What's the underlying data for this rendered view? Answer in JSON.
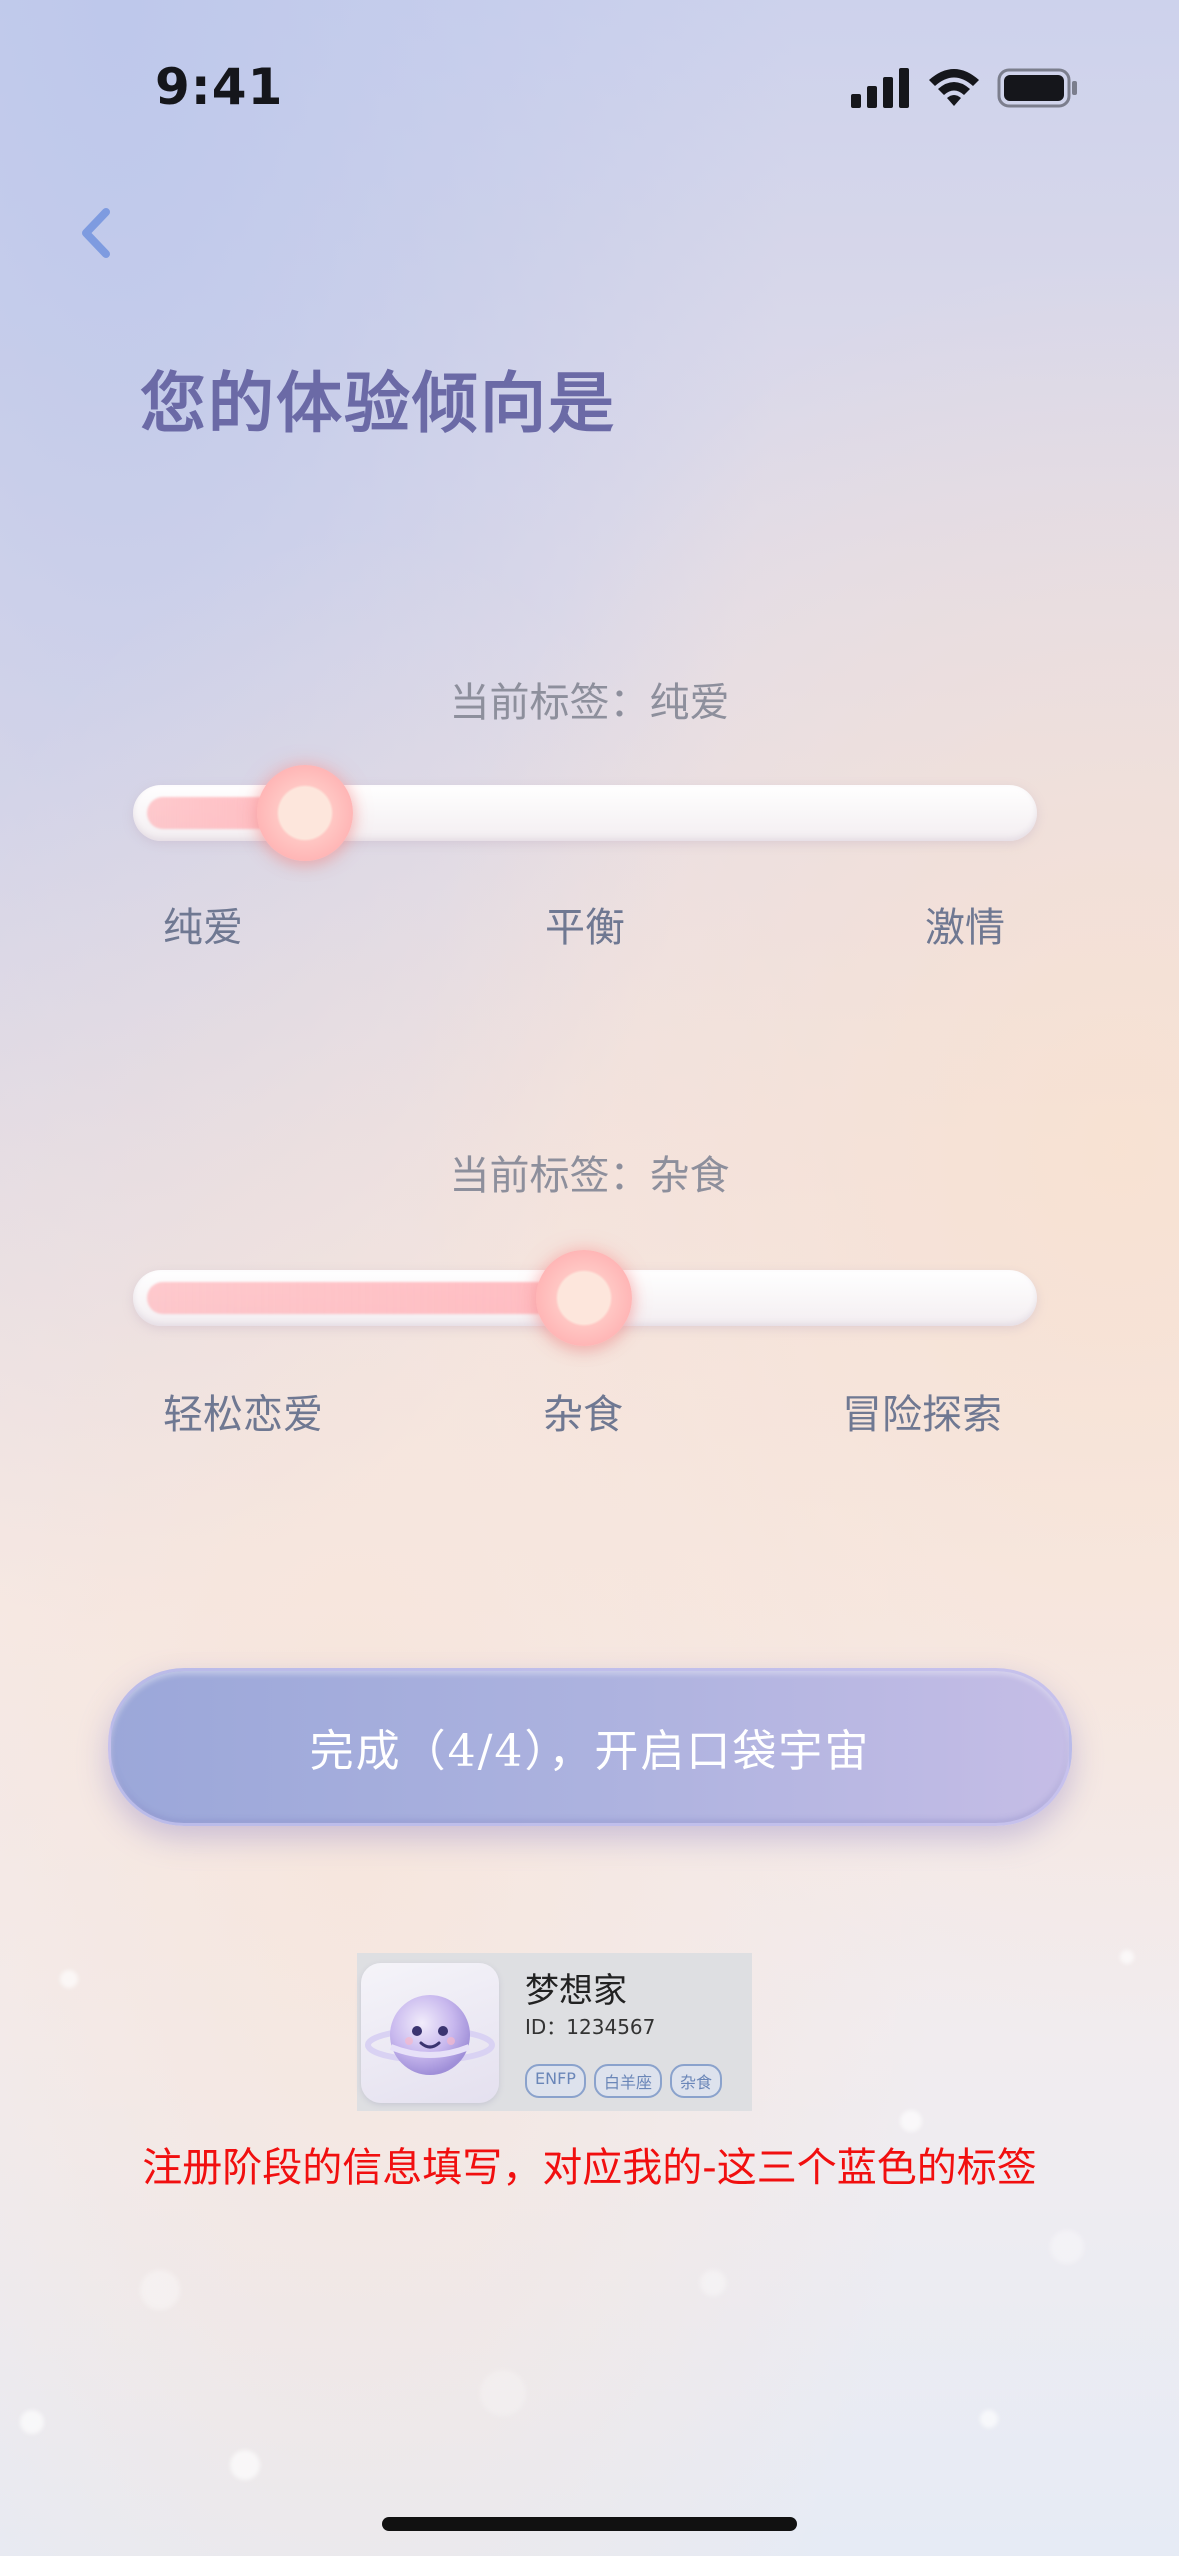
{
  "status_bar": {
    "time": "9:41"
  },
  "header": {
    "title": "您的体验倾向是"
  },
  "sliders": [
    {
      "current_label": "当前标签：纯爱",
      "value": 0.19,
      "ticks": [
        "纯爱",
        "平衡",
        "激情"
      ]
    },
    {
      "current_label": "当前标签：杂食",
      "value": 0.5,
      "ticks": [
        "轻松恋爱",
        "杂食",
        "冒险探索"
      ]
    }
  ],
  "cta": {
    "label": "完成（4/4），开启口袋宇宙"
  },
  "profile_card": {
    "name": "梦想家",
    "id": "ID：1234567",
    "tags": [
      "ENFP",
      "白羊座",
      "杂食"
    ]
  },
  "annotation": {
    "text": "注册阶段的信息填写，对应我的-这三个蓝色的标签"
  },
  "colors": {
    "title": "#6b6aa6",
    "accent_back": "#7e9be0",
    "cta_start": "#9ba7d9",
    "cta_end": "#c5bde6",
    "annotation": "#f10f0f",
    "tag_blue": "#6a86b8"
  },
  "icons": [
    "signal-icon",
    "wifi-icon",
    "battery-icon",
    "back-chevron-icon"
  ]
}
